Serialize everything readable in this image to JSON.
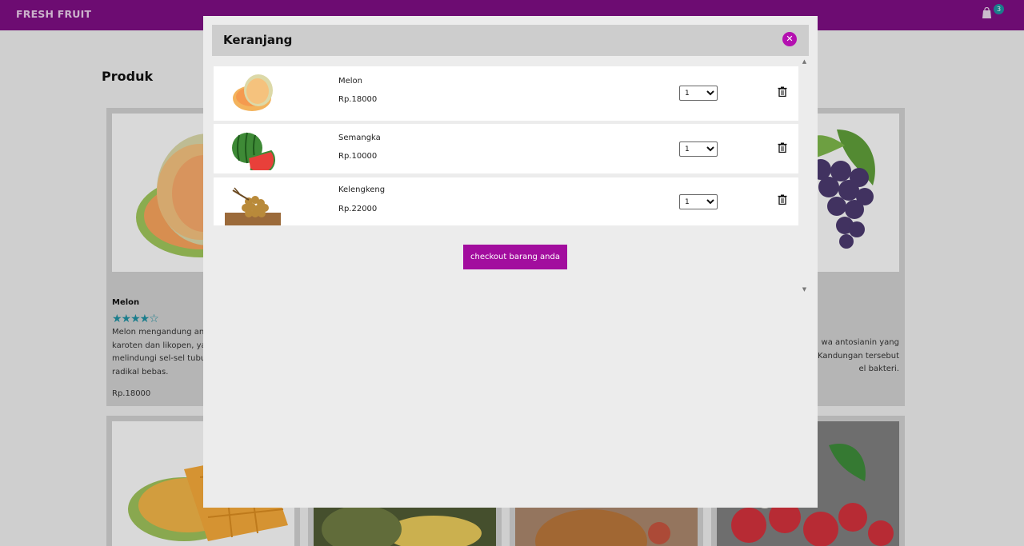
{
  "navbar": {
    "brand": "FRESH FRUIT",
    "cart_count": "3",
    "cart_icon": "shopping-bag-icon"
  },
  "page": {
    "title": "Produk",
    "cards": [
      {
        "name": "Melon",
        "rating": 4,
        "stars_text": "★★★★☆",
        "description": "Melon mengandung anti… karoten dan likopen, yang… melindungi sel-sel tubuh… radikal bebas.",
        "desc_lines": [
          "Melon mengandung anti",
          "karoten dan likopen, yang",
          "melindungi sel-sel tubuh",
          "radikal bebas."
        ],
        "price": "Rp.18000"
      },
      {
        "name": "",
        "desc_lines": [
          "wa antosianin yang",
          " Kandungan tersebut",
          "el bakteri."
        ]
      }
    ]
  },
  "modal": {
    "title": "Keranjang",
    "close_icon": "close-icon",
    "items": [
      {
        "name": "Melon",
        "price": "Rp.18000",
        "qty": "1",
        "image": "melon",
        "delete_icon": "trash-icon"
      },
      {
        "name": "Semangka",
        "price": "Rp.10000",
        "qty": "1",
        "image": "watermelon",
        "delete_icon": "trash-icon"
      },
      {
        "name": "Kelengkeng",
        "price": "Rp.22000",
        "qty": "1",
        "image": "longan",
        "delete_icon": "trash-icon"
      }
    ],
    "qty_options": [
      "1"
    ],
    "checkout_label": "checkout barang anda"
  },
  "colors": {
    "navbar": "#7d0e82",
    "accent": "#a20d9e",
    "badge": "#1f8fa0",
    "star": "#1f8fa0"
  }
}
